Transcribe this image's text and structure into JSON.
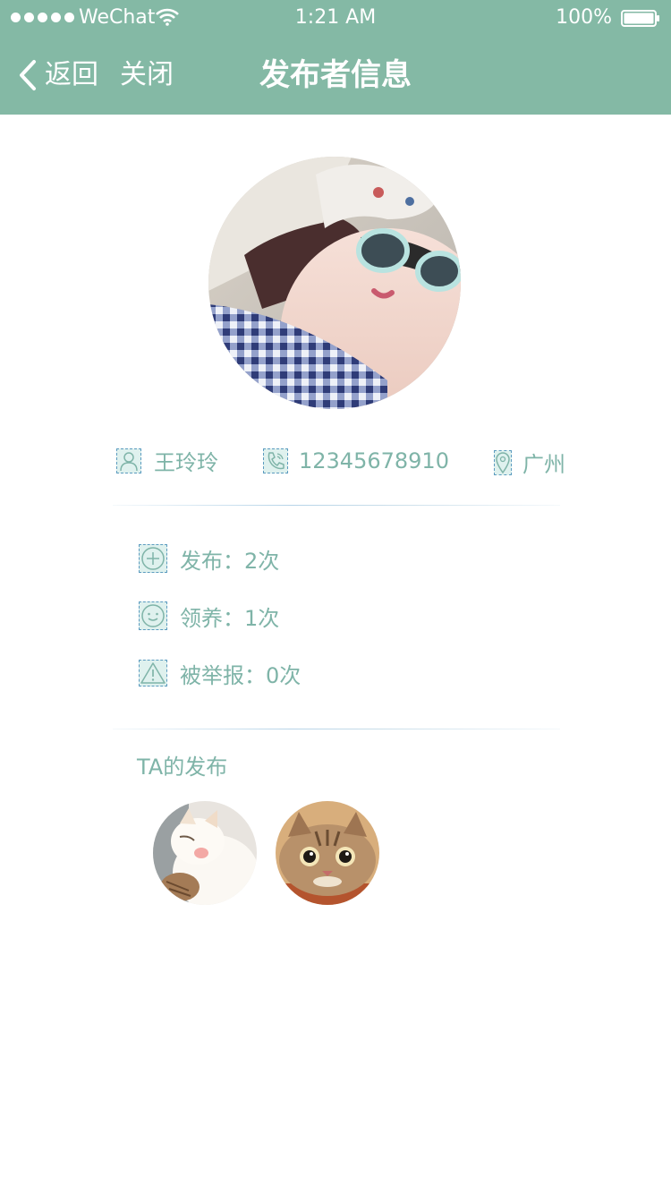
{
  "status_bar": {
    "carrier": "WeChat",
    "time": "1:21 AM",
    "battery": "100%"
  },
  "nav": {
    "back_label": "返回",
    "close_label": "关闭",
    "title": "发布者信息"
  },
  "profile": {
    "name": "王玲玲",
    "phone": "12345678910",
    "city": "广州"
  },
  "stats": [
    {
      "label": "发布：2次",
      "icon": "plus-circle-icon"
    },
    {
      "label": "领养：1次",
      "icon": "smiley-icon"
    },
    {
      "label": "被举报：0次",
      "icon": "warning-icon"
    }
  ],
  "posts_section": {
    "title": "TA的发布"
  },
  "colors": {
    "header": "#84b9a5",
    "accent_text": "#7fb4a8"
  }
}
